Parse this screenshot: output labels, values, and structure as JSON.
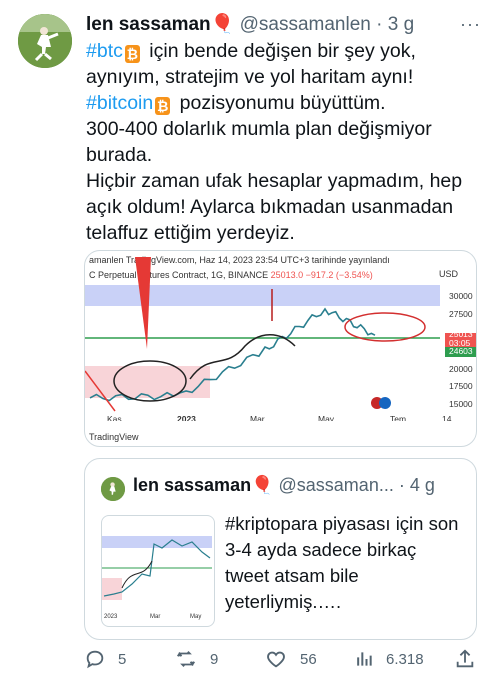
{
  "tweet": {
    "author_name": "len sassaman",
    "author_emoji": "🎈",
    "handle": "@sassamanlen",
    "separator": "·",
    "time": "3 g",
    "more": "···",
    "line1_tag": "#btc",
    "line1_text": "için bende değişen bir şey yok, aynıyım, stratejim ve yol haritam aynı!",
    "line2_tag": "#bitcoin",
    "line2_text": "pozisyonumu büyüttüm.",
    "line3": "300-400 dolarlık mumla plan değişmiyor burada.",
    "line4": "Hiçbir zaman ufak hesaplar yapmadım, hep açık oldum! Aylarca bıkmadan usanmadan telaffuz ettiğim yerdeyiz."
  },
  "chart": {
    "header_line1": "amanlen TradingView.com, Haz 14, 2023 23:54 UTC+3 tarihinde yayınlandı",
    "header_line2_prefix": "C Perpetual Futures Contract, 1G, BINANCE",
    "header_line2_price": "25013.0",
    "header_line2_change": "−917.2 (−3.54%)",
    "currency": "USD",
    "y_ticks": [
      "30000",
      "27500",
      "25013",
      "03:05",
      "24603",
      "20000",
      "17500",
      "15000"
    ],
    "x_ticks": [
      "Kas",
      "2023",
      "Mar",
      "May",
      "Tem",
      "14"
    ],
    "watermark": "TradingView",
    "colors": {
      "support_line": "#2e9d4f",
      "resistance_zone": "#c9d1f7",
      "buy_zone": "#f8d4d8",
      "price_badge": "#ef5350",
      "support_badge": "#2e9d4f"
    }
  },
  "chart_data": {
    "type": "line",
    "title": "",
    "xlabel": "",
    "ylabel": "",
    "x": [
      "Kas",
      "2023",
      "Mar",
      "May",
      "Tem"
    ],
    "series": [
      {
        "values": [
          16500,
          16800,
          23000,
          28500,
          25013
        ]
      }
    ],
    "ylim": [
      15000,
      31000
    ],
    "grid": false
  },
  "quote": {
    "author_name": "len sassaman",
    "author_emoji": "🎈",
    "handle": "@sassaman...",
    "separator": "·",
    "time": "4 g",
    "text": "#kriptopara piyasası için son 3-4 ayda sadece birkaç tweet atsam bile yeterliymiş.….",
    "thumb_ticks": [
      "2023",
      "Mar",
      "May"
    ]
  },
  "actions": {
    "replies": "5",
    "retweets": "9",
    "likes": "56",
    "views": "6.318"
  }
}
